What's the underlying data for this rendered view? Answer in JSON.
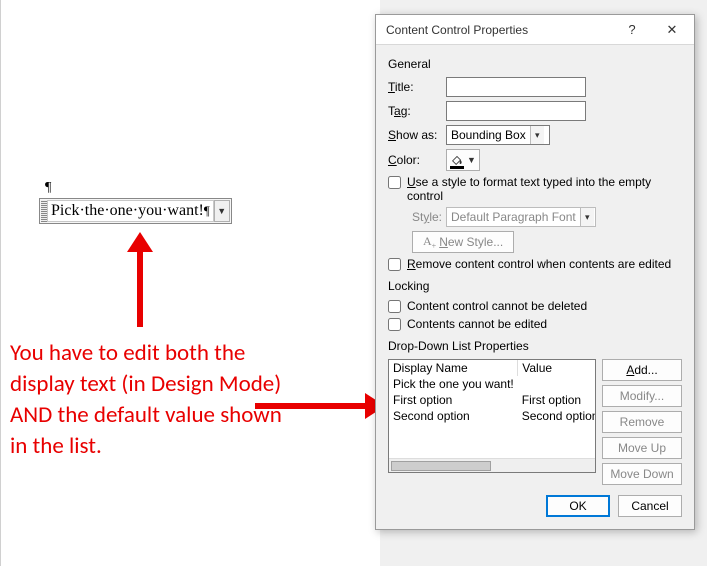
{
  "document": {
    "paragraph_mark": "¶",
    "dropdown_text": "Pick·the·one·you·want!",
    "end_mark": "¶"
  },
  "annotation": {
    "text": "You have to edit both the display text (in Design Mode) AND the default value shown in the list."
  },
  "dialog": {
    "title": "Content Control Properties",
    "help": "?",
    "close": "✕",
    "sections": {
      "general": "General",
      "locking": "Locking",
      "ddl": "Drop-Down List Properties"
    },
    "labels": {
      "title": "Title:",
      "tag": "Tag:",
      "show_as": "Show as:",
      "color": "Color:",
      "style": "Style:",
      "new_style": "New Style...",
      "display_name": "Display Name",
      "value": "Value"
    },
    "values": {
      "title": "",
      "tag": "",
      "show_as": "Bounding Box",
      "style": "Default Paragraph Font"
    },
    "checkboxes": {
      "use_style": "Use a style to format text typed into the empty control",
      "remove_on_edit": "Remove content control when contents are edited",
      "no_delete": "Content control cannot be deleted",
      "no_edit": "Contents cannot be edited"
    },
    "list_items": [
      {
        "display": "Pick the one you want!",
        "value": ""
      },
      {
        "display": "First option",
        "value": "First option"
      },
      {
        "display": "Second option",
        "value": "Second option"
      }
    ],
    "buttons": {
      "add": "Add...",
      "modify": "Modify...",
      "remove": "Remove",
      "move_up": "Move Up",
      "move_down": "Move Down",
      "ok": "OK",
      "cancel": "Cancel"
    }
  }
}
